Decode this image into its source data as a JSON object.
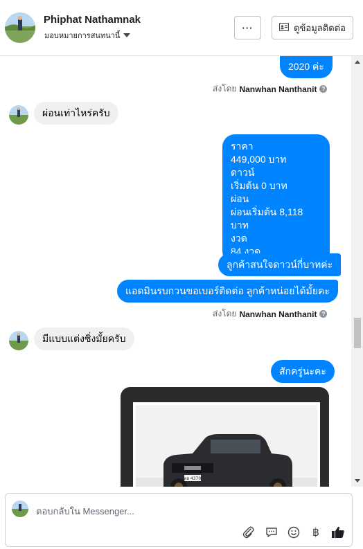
{
  "header": {
    "contact_name": "Phiphat Nathamnak",
    "assign_label": "มอบหมายการสนทนานี้",
    "more_label": "···",
    "contact_info_label": "ดูข้อมูลติดต่อ"
  },
  "messages": {
    "out_year": "2020 ค่ะ",
    "sent_by_prefix_1": "ส่งโดย",
    "sent_by_name_1": "Nanwhan Nanthanit",
    "in_1": "ผ่อนเท่าไหร่ครับ",
    "price_lines": [
      "ราคา",
      "449,000 บาท",
      "ดาวน์",
      "เริ่มต้น 0 บาท",
      "ผ่อน",
      "ผ่อนเริ่มต้น 8,118 บาท",
      "งวด",
      "84 งวด"
    ],
    "out_q1": "ลูกค้าสนใจดาวน์กี่บาทค่ะ",
    "out_q2": "แอดมินรบกวนขอเบอร์ติดต่อ ลูกค้าหน่อยได้มั้ยคะ",
    "sent_by_prefix_2": "ส่งโดย",
    "sent_by_name_2": "Nanwhan Nanthanit",
    "in_2": "มีแบบแต่งซิ่งมั้ยครับ",
    "out_q3": "สักครู่นะคะ",
    "photo_plate": "ผล 4370"
  },
  "composer": {
    "placeholder": "ตอบกลับใน Messenger..."
  },
  "colors": {
    "outgoing": "#0084ff",
    "incoming": "#f0f0f0",
    "like": "#1c1e21"
  }
}
